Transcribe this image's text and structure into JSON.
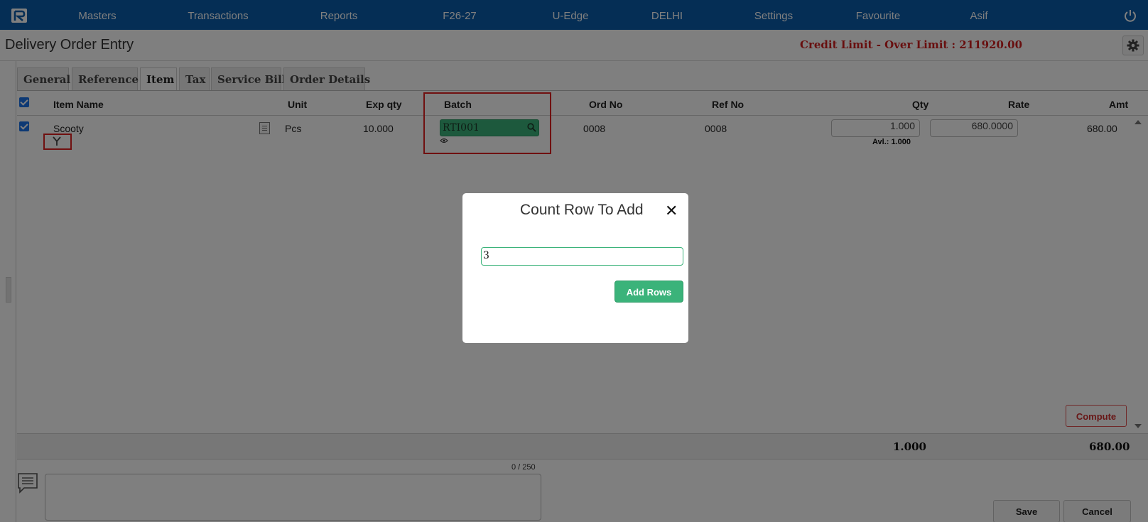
{
  "nav": {
    "items": [
      "Masters",
      "Transactions",
      "Reports",
      "F26-27",
      "U-Edge",
      "DELHI",
      "Settings",
      "Favourite",
      "Asif"
    ]
  },
  "page": {
    "title": "Delivery Order Entry",
    "credit_warning": "Credit Limit - Over Limit : 211920.00"
  },
  "tabs": [
    "General",
    "Reference",
    "Item",
    "Tax",
    "Service Bill",
    "Order Details"
  ],
  "active_tab": "Item",
  "table": {
    "headers": {
      "item_name": "Item Name",
      "unit": "Unit",
      "exp_qty": "Exp qty",
      "batch": "Batch",
      "ord_no": "Ord No",
      "ref_no": "Ref No",
      "qty": "Qty",
      "rate": "Rate",
      "amt": "Amt"
    },
    "rows": [
      {
        "item_name": "Scooty",
        "unit": "Pcs",
        "exp_qty": "10.000",
        "batch": "RTI001",
        "ord_no": "0008",
        "ref_no": "0008",
        "qty": "1.000",
        "available": "Avl.: 1.000",
        "rate": "680.0000",
        "amt": "680.00"
      }
    ]
  },
  "buttons": {
    "compute": "Compute",
    "save": "Save",
    "cancel": "Cancel"
  },
  "totals": {
    "qty": "1.000",
    "amt": "680.00"
  },
  "remarks": {
    "counter": "0 / 250"
  },
  "modal": {
    "title": "Count Row To Add",
    "close": "✕",
    "input_value": "3",
    "button": "Add Rows"
  },
  "colors": {
    "nav_bg": "#0a5cab",
    "accent_green": "#3bb37a",
    "credit_red": "#d11f1f",
    "highlight_red": "#e02020"
  }
}
